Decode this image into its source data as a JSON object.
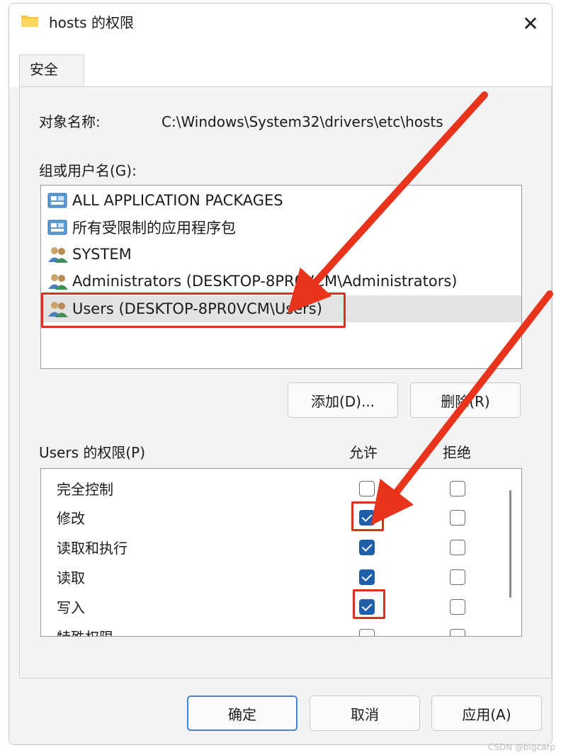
{
  "window": {
    "title": "hosts 的权限",
    "close_glyph": "✕"
  },
  "tabs": [
    {
      "label": "安全",
      "selected": true
    }
  ],
  "object": {
    "label": "对象名称:",
    "value": "C:\\Windows\\System32\\drivers\\etc\\hosts"
  },
  "groups": {
    "label": "组或用户名(G):",
    "items": [
      {
        "label": "ALL APPLICATION PACKAGES",
        "icon": "package-group-icon"
      },
      {
        "label": "所有受限制的应用程序包",
        "icon": "package-group-icon"
      },
      {
        "label": "SYSTEM",
        "icon": "users-group-icon"
      },
      {
        "label": "Administrators (DESKTOP-8PR0VCM\\Administrators)",
        "icon": "users-group-icon"
      },
      {
        "label": "Users (DESKTOP-8PR0VCM\\Users)",
        "icon": "users-group-icon",
        "selected": true
      }
    ],
    "add_button": "添加(D)...",
    "remove_button": "删除(R)"
  },
  "permissions": {
    "label": "Users 的权限(P)",
    "allow_header": "允许",
    "deny_header": "拒绝",
    "rows": [
      {
        "name": "完全控制",
        "allow": false,
        "deny": false
      },
      {
        "name": "修改",
        "allow": true,
        "deny": false
      },
      {
        "name": "读取和执行",
        "allow": true,
        "deny": false
      },
      {
        "name": "读取",
        "allow": true,
        "deny": false
      },
      {
        "name": "写入",
        "allow": true,
        "deny": false
      },
      {
        "name": "特殊权限",
        "allow": false,
        "deny": false
      }
    ]
  },
  "footer": {
    "ok": "确定",
    "cancel": "取消",
    "apply": "应用(A)"
  },
  "watermark": "CSDN @bigcarp",
  "colors": {
    "accent": "#1f5fa9",
    "highlight": "#d9311b",
    "selected_row": "#e3e3e3"
  }
}
